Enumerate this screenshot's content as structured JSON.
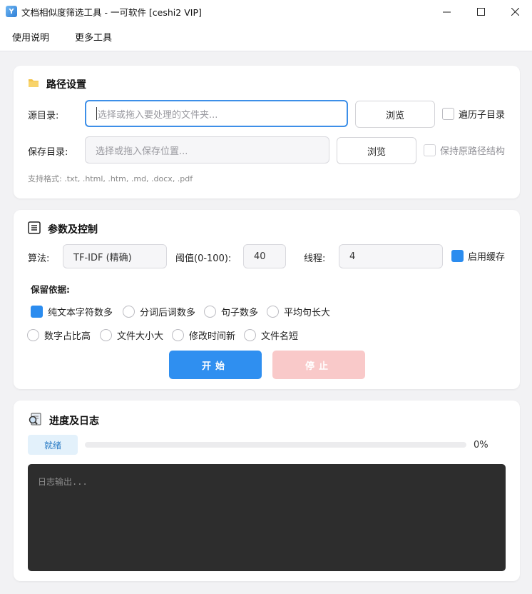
{
  "window": {
    "title": "文档相似度筛选工具 - 一可软件 [ceshi2 VIP]",
    "controls": [
      "minimize-icon",
      "maximize-icon",
      "close-icon"
    ]
  },
  "menu": {
    "items": [
      {
        "label": "使用说明"
      },
      {
        "label": "更多工具"
      }
    ]
  },
  "path_settings": {
    "title": "路径设置",
    "icon": "folder-icon",
    "source_label": "源目录:",
    "source_placeholder": "选择或拖入要处理的文件夹...",
    "source_browse": "浏览",
    "recursive_label": "遍历子目录",
    "recursive_checked": false,
    "save_label": "保存目录:",
    "save_placeholder": "选择或拖入保存位置...",
    "save_browse": "浏览",
    "keep_structure_label": "保持原路径结构",
    "keep_structure_checked": false,
    "formats_note": "支持格式: .txt, .html, .htm, .md, .docx, .pdf"
  },
  "params": {
    "title": "参数及控制",
    "icon": "list-icon",
    "algo_label": "算法:",
    "algo_value": "TF-IDF (精确)",
    "threshold_label": "阈值(0-100):",
    "threshold_value": "40",
    "threads_label": "线程:",
    "threads_value": "4",
    "cache_label": "启用缓存",
    "cache_checked": true,
    "keep_basis_label": "保留依据:",
    "options": [
      {
        "label": "纯文本字符数多",
        "selected": true
      },
      {
        "label": "分词后词数多",
        "selected": false
      },
      {
        "label": "句子数多",
        "selected": false
      },
      {
        "label": "平均句长大",
        "selected": false
      },
      {
        "label": "数字占比高",
        "selected": false
      },
      {
        "label": "文件大小大",
        "selected": false
      },
      {
        "label": "修改时间新",
        "selected": false
      },
      {
        "label": "文件名短",
        "selected": false
      }
    ],
    "start_label": "开始",
    "stop_label": "停止"
  },
  "progress": {
    "title": "进度及日志",
    "icon": "search-document-icon",
    "status": "就绪",
    "percent_text": "0%",
    "percent": 0,
    "log_placeholder": "日志输出..."
  },
  "colors": {
    "accent": "#2f8ff0",
    "stop_disabled": "#f9c9c9",
    "log_bg": "#2d2d2d"
  }
}
